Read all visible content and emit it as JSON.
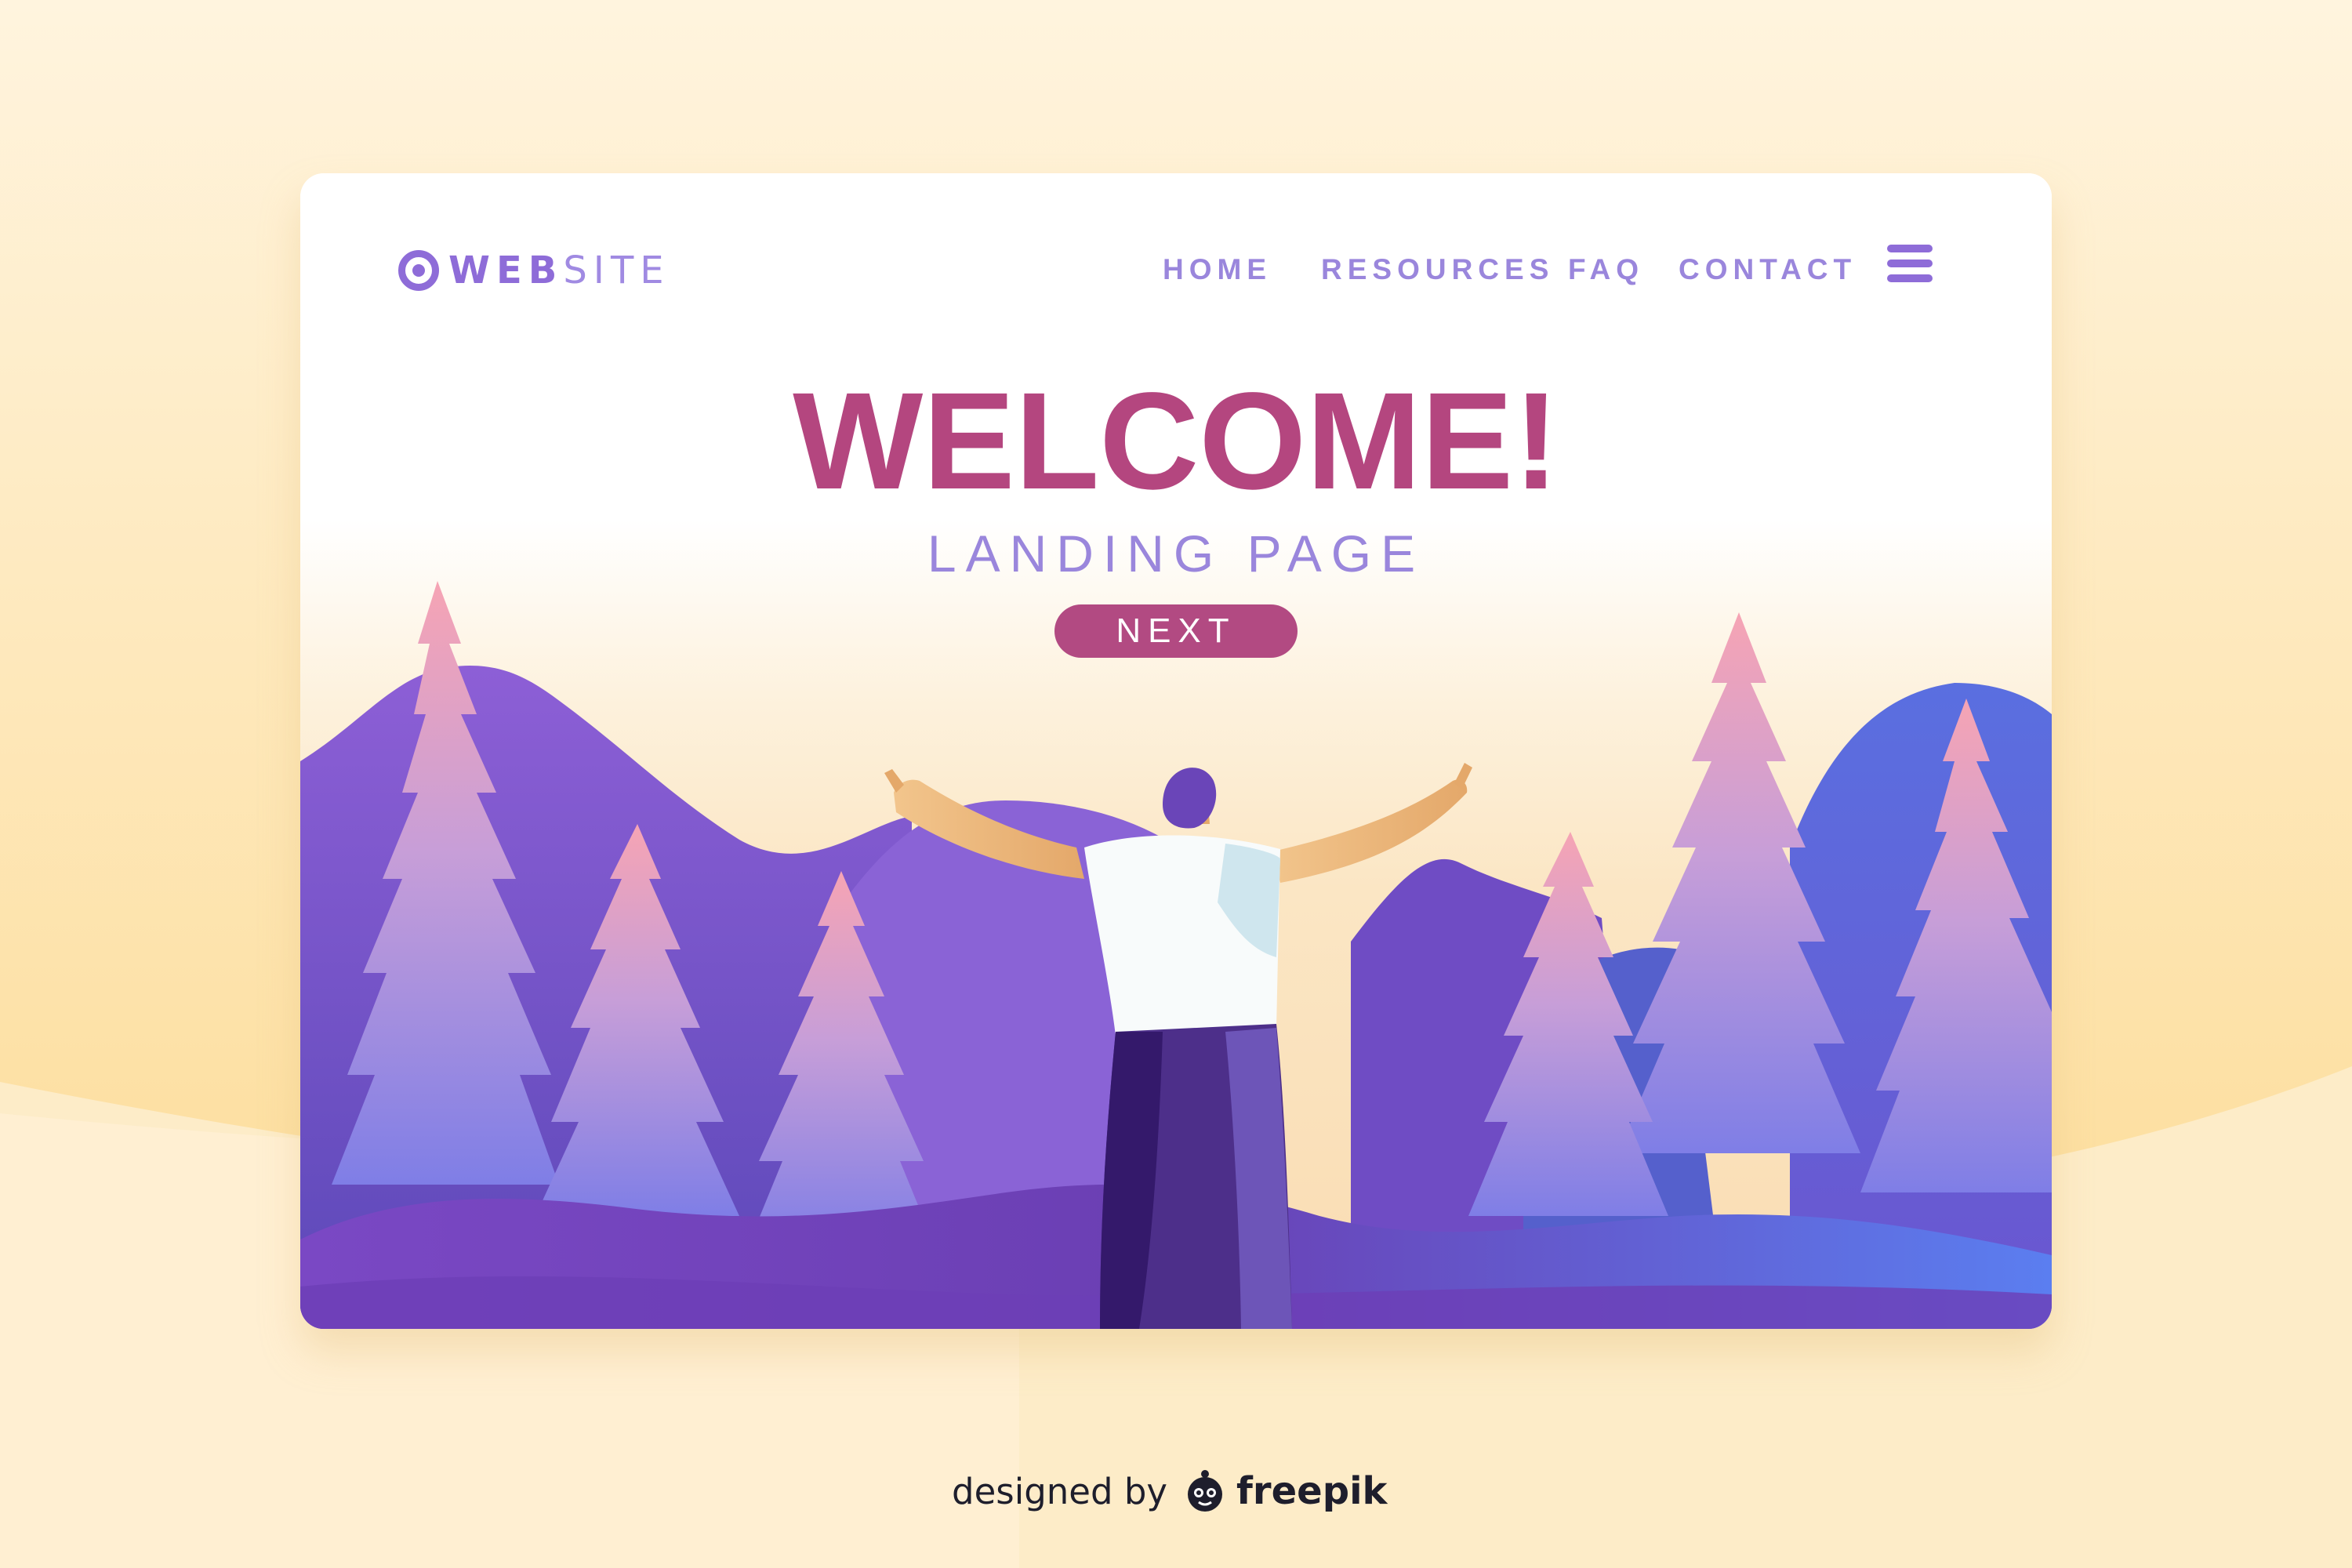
{
  "colors": {
    "brand_purple": "#8e6cd8",
    "nav_text": "#9a86dc",
    "title_magenta": "#b4467f",
    "button_bg": "#b24a82",
    "page_background": "#fdebc6"
  },
  "header": {
    "logo": {
      "bold_part": "WEB",
      "light_part": "SITE"
    },
    "nav": [
      {
        "label": "HOME"
      },
      {
        "label": "RESOURCES"
      },
      {
        "label": "FAQ"
      },
      {
        "label": "CONTACT"
      }
    ],
    "menu_icon": "hamburger-menu-icon"
  },
  "hero": {
    "title": "WELCOME!",
    "subtitle": "LANDING PAGE",
    "cta_label": "NEXT"
  },
  "footer": {
    "credit_prefix": "designed by",
    "credit_brand": "freepik",
    "credit_icon": "freepik-logo-icon"
  }
}
